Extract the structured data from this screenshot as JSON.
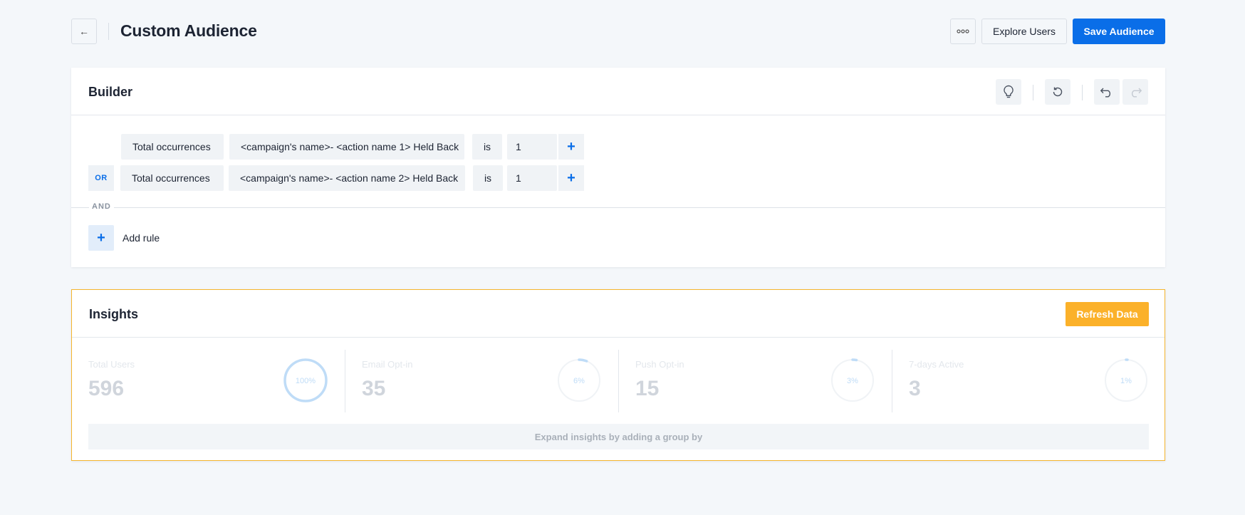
{
  "header": {
    "back_icon": "arrow-left-icon",
    "title": "Custom Audience",
    "more_icon": "ellipsis-icon",
    "explore_label": "Explore Users",
    "save_label": "Save Audience"
  },
  "builder": {
    "title": "Builder",
    "toolbar_icons": [
      "lightbulb-icon",
      "reset-icon",
      "undo-icon",
      "redo-icon"
    ],
    "rules": [
      {
        "connector": "",
        "metric": "Total occurrences",
        "event": "<campaign's name>- <action name 1> Held Back",
        "operator": "is",
        "value": "1",
        "add_symbol": "+"
      },
      {
        "connector": "OR",
        "metric": "Total occurrences",
        "event": "<campaign's name>- <action name 2> Held Back",
        "operator": "is",
        "value": "1",
        "add_symbol": "+"
      }
    ],
    "and_label": "AND",
    "add_rule_symbol": "+",
    "add_rule_label": "Add rule"
  },
  "insights": {
    "title": "Insights",
    "refresh_label": "Refresh Data",
    "stats": [
      {
        "label": "Total Users",
        "value": "596",
        "percent_label": "100%",
        "percent": 100
      },
      {
        "label": "Email Opt-in",
        "value": "35",
        "percent_label": "6%",
        "percent": 6
      },
      {
        "label": "Push Opt-in",
        "value": "15",
        "percent_label": "3%",
        "percent": 3
      },
      {
        "label": "7-days Active",
        "value": "3",
        "percent_label": "1%",
        "percent": 1
      }
    ],
    "expand_label": "Expand insights by adding a group by"
  },
  "colors": {
    "primary": "#0a6ee8",
    "accent": "#fbb12a",
    "ring": "#bfdcf7"
  }
}
